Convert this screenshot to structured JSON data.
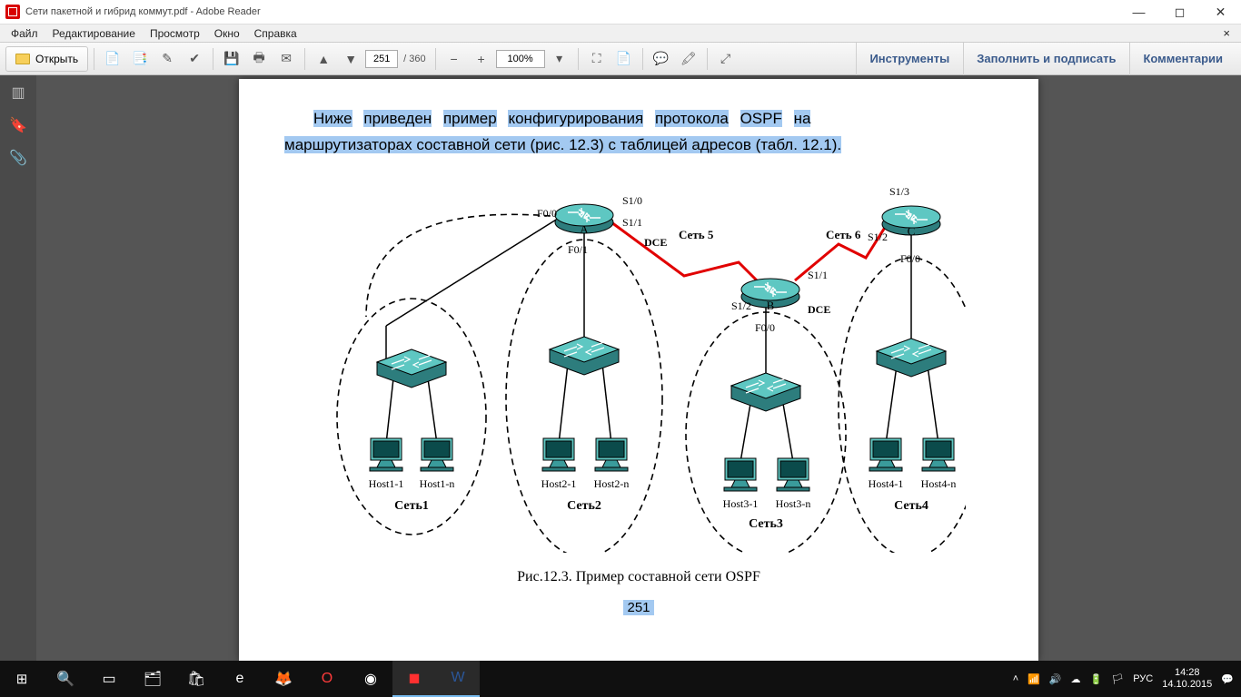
{
  "window": {
    "title": "Сети пакетной и гибрид коммут.pdf - Adobe Reader"
  },
  "menu": {
    "file": "Файл",
    "edit": "Редактирование",
    "view": "Просмотр",
    "window": "Окно",
    "help": "Справка"
  },
  "toolbar": {
    "open": "Открыть",
    "page_current": "251",
    "page_total": "/  360",
    "zoom": "100%"
  },
  "right_tools": {
    "tools": "Инструменты",
    "fill": "Заполнить и подписать",
    "comment": "Комментарии"
  },
  "document": {
    "para_parts": [
      "Ниже",
      "приведен",
      "пример",
      "конфигурирования",
      "протокола",
      "OSPF",
      "на"
    ],
    "para_line2": "маршрутизаторах составной сети (рис. 12.3) с таблицей адресов (табл. 12.1).",
    "caption": "Рис.12.3. Пример составной сети OSPF",
    "page_number": "251"
  },
  "diagram": {
    "routers": {
      "A": "A",
      "B": "B",
      "C": "C"
    },
    "ports": {
      "A_F00": "F0/0",
      "A_S10": "S1/0",
      "A_S11": "S1/1",
      "A_F01": "F0/1",
      "B_S12": "S1/2",
      "B_S11": "S1/1",
      "B_F00": "F0/0",
      "C_S13": "S1/3",
      "C_S12": "S1/2",
      "C_F00": "F0/0"
    },
    "dce1": "DCE",
    "dce2": "DCE",
    "nets": {
      "n1": "Сеть1",
      "n2": "Сеть2",
      "n3": "Сеть3",
      "n4": "Сеть4",
      "n5": "Сеть 5",
      "n6": "Сеть 6"
    },
    "hosts": {
      "h11": "Host1-1",
      "h1n": "Host1-n",
      "h21": "Host2-1",
      "h2n": "Host2-n",
      "h31": "Host3-1",
      "h3n": "Host3-n",
      "h41": "Host4-1",
      "h4n": "Host4-n"
    }
  },
  "taskbar": {
    "lang": "РУС",
    "time": "14:28",
    "date": "14.10.2015"
  }
}
